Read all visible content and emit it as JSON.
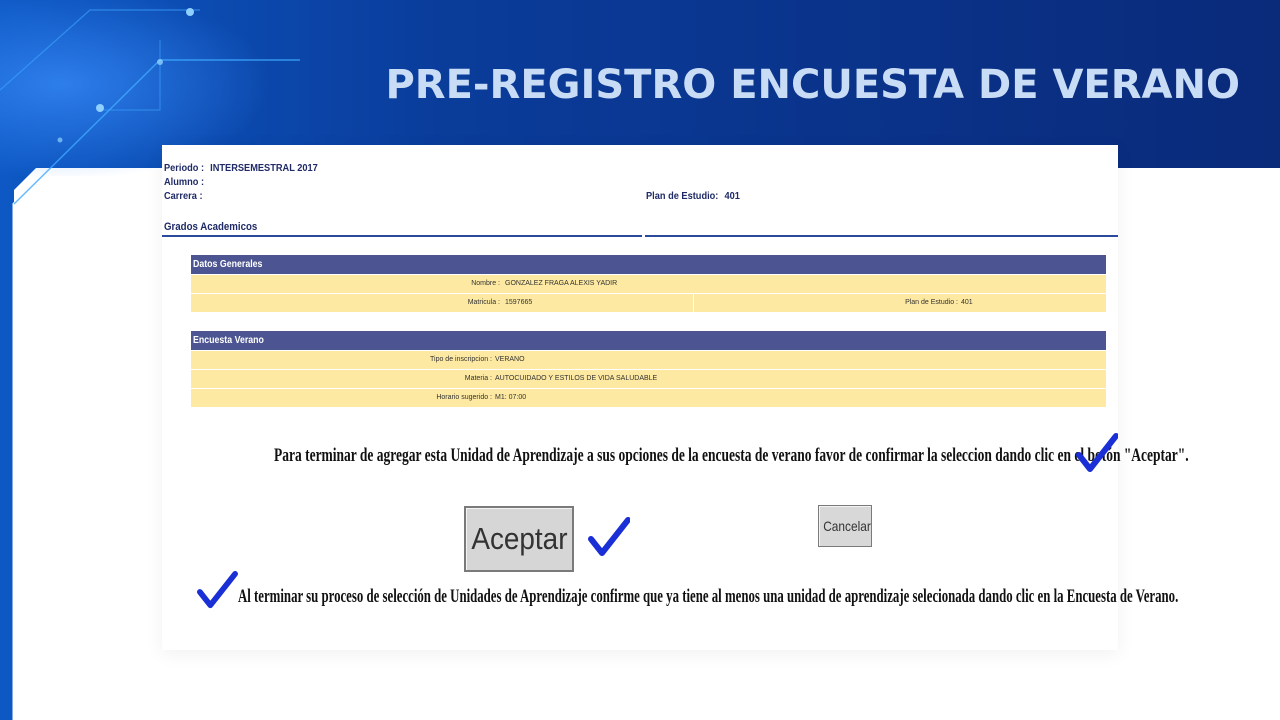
{
  "slide": {
    "title": "PRE-REGISTRO ENCUESTA DE VERANO",
    "colors": {
      "banner": "#0a2a7a",
      "title": "#c9dcf6",
      "accent_line": "#3fa9ff"
    }
  },
  "header": {
    "periodo_label": "Periodo :",
    "periodo_value": "INTERSEMESTRAL 2017",
    "alumno_label": "Alumno :",
    "carrera_label": "Carrera :",
    "plan_label": "Plan de Estudio:",
    "plan_value": "401",
    "grados_label": "Grados Academicos"
  },
  "datos_generales": {
    "title": "Datos Generales",
    "nombre_label": "Nombre :",
    "nombre_value": "GONZALEZ FRAGA ALEXIS YADIR",
    "matricula_label": "Matricula :",
    "matricula_value": "1597665",
    "plan_label": "Plan de Estudio :",
    "plan_value": "401"
  },
  "encuesta_verano": {
    "title": "Encuesta Verano",
    "tipo_label": "Tipo de inscripcion :",
    "tipo_value": "VERANO",
    "materia_label": "Materia :",
    "materia_value": "AUTOCUIDADO Y ESTILOS DE VIDA SALUDABLE",
    "horario_label": "Horario sugerido :",
    "horario_value": "M1: 07:00"
  },
  "instructions": {
    "confirm": "Para terminar de agregar esta Unidad de Aprendizaje a sus opciones de la encuesta de verano favor de confirmar la seleccion dando clic en el botón \"Aceptar\".",
    "finish": "Al terminar su proceso de selección de Unidades de Aprendizaje confirme que ya tiene al menos una unidad de aprendizaje selecionada dando clic en la Encuesta de Verano."
  },
  "buttons": {
    "aceptar": "Aceptar",
    "cancelar": "Cancelar"
  },
  "icons": {
    "check": "checkmark-icon",
    "check_color": "#1a2fd6"
  }
}
